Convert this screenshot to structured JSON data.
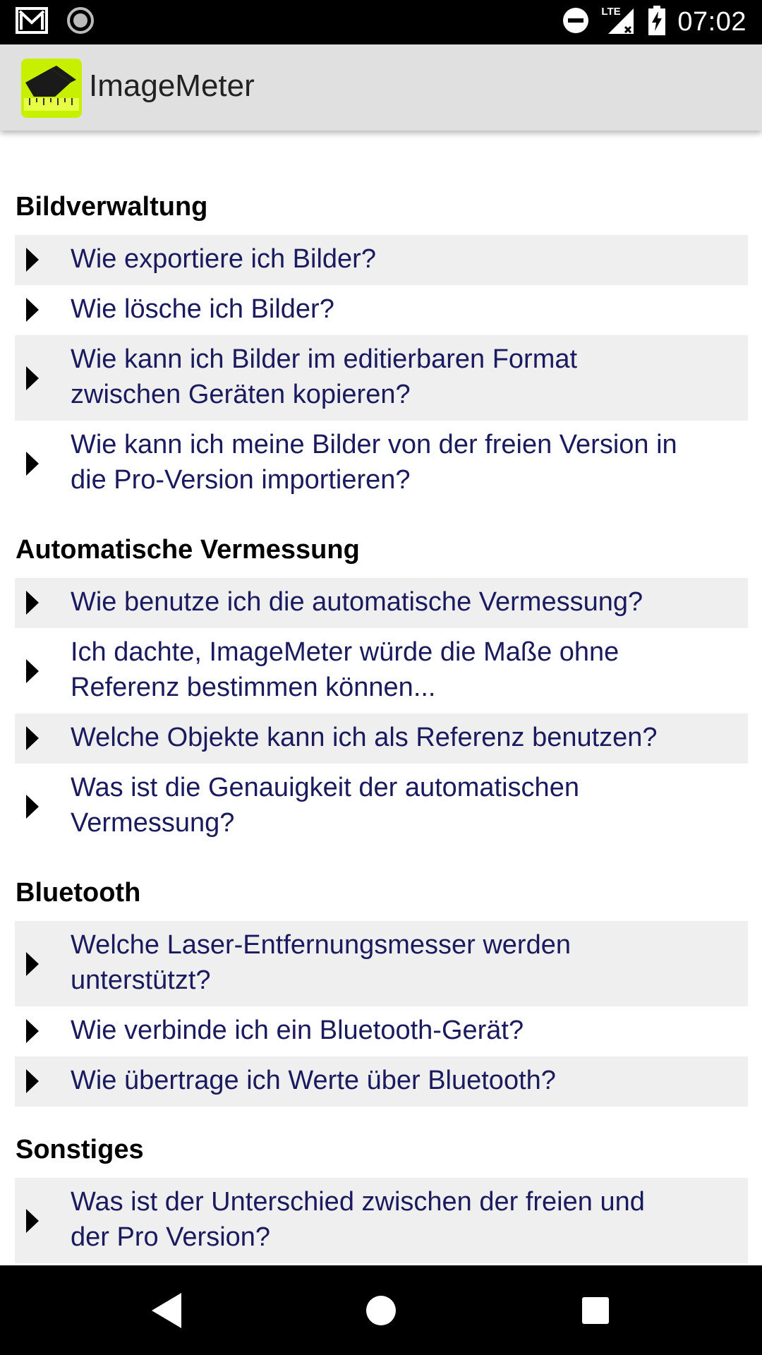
{
  "status_bar": {
    "time": "07:02",
    "network_label": "LTE",
    "icons": [
      "gmail-icon",
      "record-icon",
      "do-not-disturb-icon",
      "signal-icon",
      "battery-charging-icon"
    ]
  },
  "app_bar": {
    "title": "ImageMeter",
    "logo": "imagemeter-logo"
  },
  "sections": [
    {
      "title": "Bildverwaltung",
      "items": [
        {
          "line1": "Wie exportiere ich Bilder?",
          "line2": ""
        },
        {
          "line1": "Wie lösche ich Bilder?",
          "line2": ""
        },
        {
          "line1": "Wie kann ich Bilder im editierbaren Format",
          "line2": "zwischen Geräten kopieren?"
        },
        {
          "line1": "Wie kann ich meine Bilder von der freien Version in",
          "line2": "die Pro-Version importieren?"
        }
      ]
    },
    {
      "title": "Automatische Vermessung",
      "items": [
        {
          "line1": "Wie benutze ich die automatische Vermessung?",
          "line2": ""
        },
        {
          "line1": "Ich dachte, ImageMeter würde die Maße ohne",
          "line2": "Referenz bestimmen können..."
        },
        {
          "line1": "Welche Objekte kann ich als Referenz benutzen?",
          "line2": ""
        },
        {
          "line1": "Was ist die Genauigkeit der automatischen",
          "line2": "Vermessung?"
        }
      ]
    },
    {
      "title": "Bluetooth",
      "items": [
        {
          "line1": "Welche Laser-Entfernungsmesser werden",
          "line2": "unterstützt?"
        },
        {
          "line1": "Wie verbinde ich ein Bluetooth-Gerät?",
          "line2": ""
        },
        {
          "line1": "Wie übertrage ich Werte über Bluetooth?",
          "line2": ""
        }
      ]
    },
    {
      "title": "Sonstiges",
      "items": [
        {
          "line1": "Was ist der Unterschied zwischen der freien und",
          "line2": "der Pro Version?"
        }
      ]
    }
  ],
  "nav_bar": {
    "buttons": [
      "back-icon",
      "home-icon",
      "recents-icon"
    ]
  },
  "colors": {
    "link_text": "#1a1a5e",
    "row_shade": "#efefef",
    "app_bar": "#e0e0e0",
    "logo_green": "#c6f000"
  }
}
